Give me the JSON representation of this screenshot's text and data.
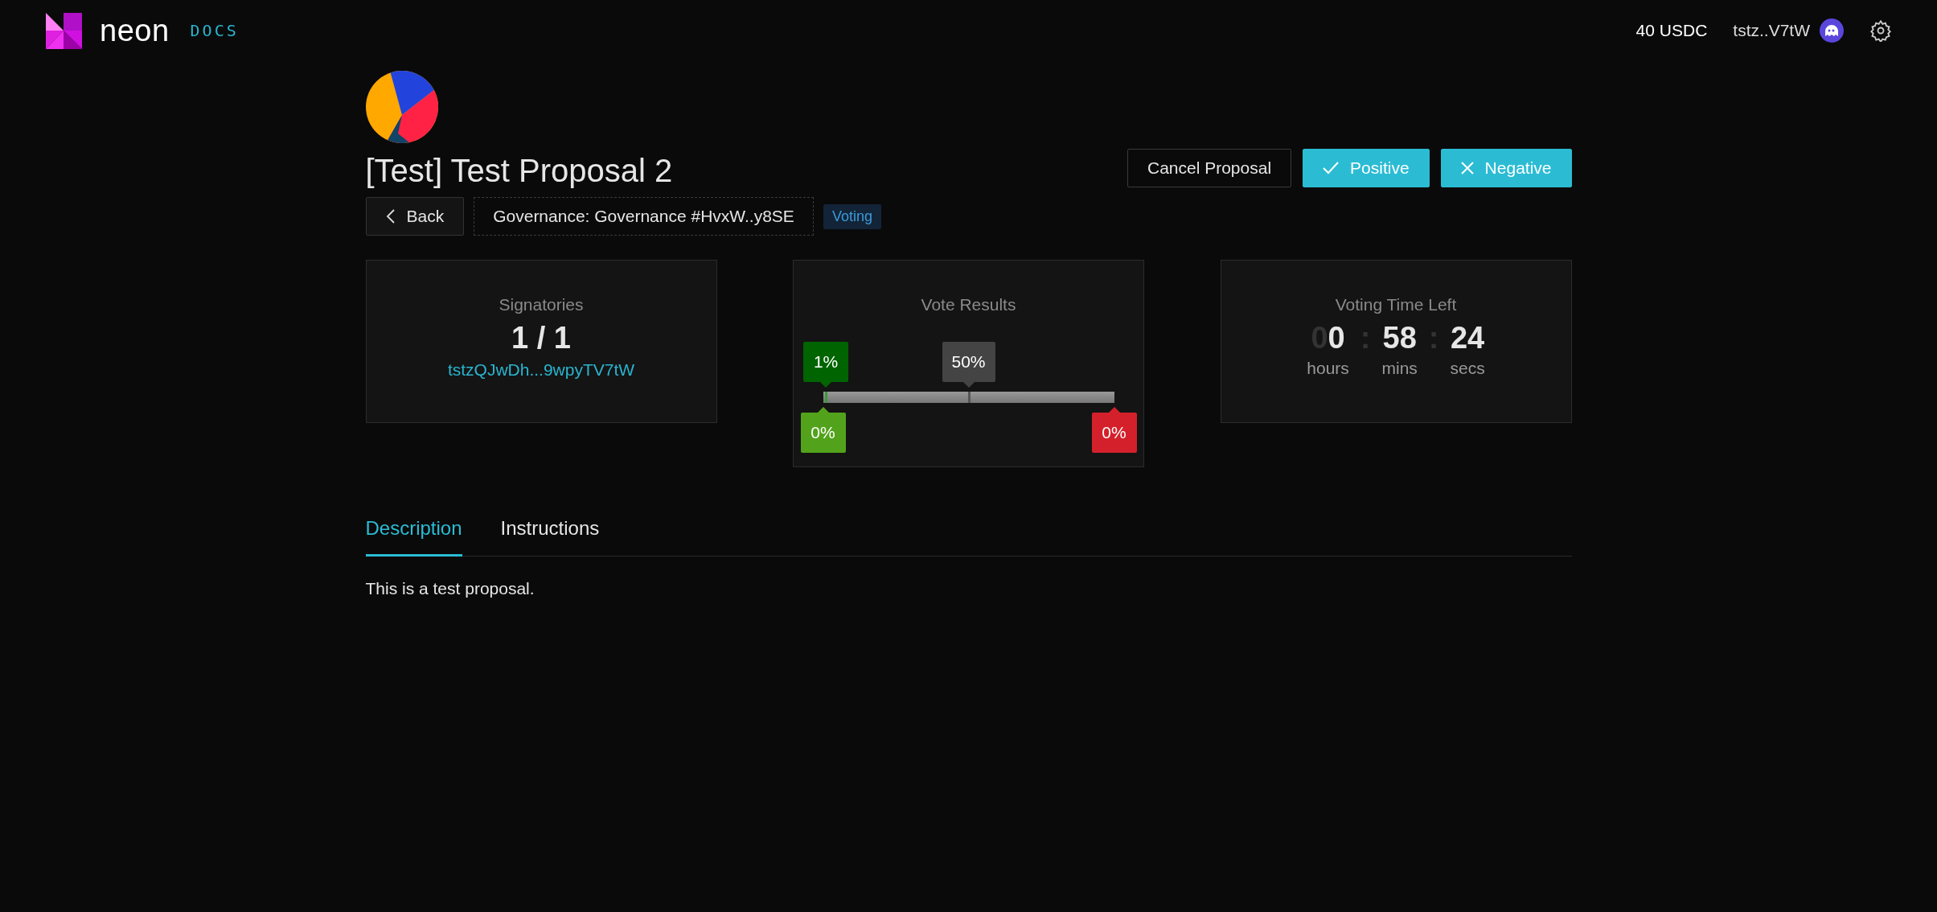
{
  "header": {
    "brand": "neon",
    "docs_link": "DOCS",
    "balance": "40 USDC",
    "wallet": "tstz..V7tW"
  },
  "proposal": {
    "title": "[Test] Test Proposal 2",
    "back": "Back",
    "governance": "Governance: Governance #HvxW..y8SE",
    "status": "Voting"
  },
  "actions": [
    {
      "label": "Cancel Proposal",
      "kind": "plain"
    },
    {
      "label": "Positive",
      "kind": "approve"
    },
    {
      "label": "Negative",
      "kind": "deny"
    }
  ],
  "signatories": {
    "title": "Signatories",
    "count": "1 / 1",
    "address": "tstzQJwDh...9wpyTV7tW"
  },
  "vote_results": {
    "title": "Vote Results",
    "thresholds": [
      {
        "label": "1%",
        "level": 0.01,
        "color": "#006400"
      },
      {
        "label": "50%",
        "level": 0.5,
        "color": "#444444"
      }
    ],
    "results": [
      {
        "label": "0%",
        "kind": "yes",
        "color": "#52a31b"
      },
      {
        "label": "0%",
        "kind": "no",
        "color": "#d4202a"
      }
    ]
  },
  "time_left": {
    "title": "Voting Time Left",
    "separator": ":",
    "units": [
      {
        "value": "00",
        "unit": "hours"
      },
      {
        "value": "58",
        "unit": "mins"
      },
      {
        "value": "24",
        "unit": "secs"
      }
    ]
  },
  "tabs": [
    {
      "label": "Description",
      "selected": true
    },
    {
      "label": "Instructions",
      "selected": false
    }
  ],
  "description": "This is a test proposal."
}
